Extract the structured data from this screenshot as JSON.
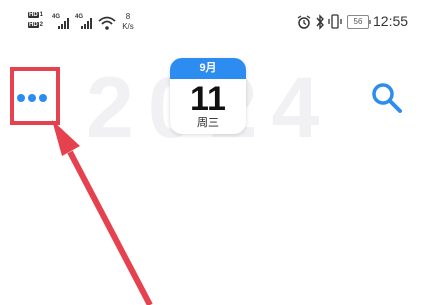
{
  "status_bar": {
    "hd_label": "HD",
    "sim1": "1",
    "sim2": "2",
    "net1": "4G",
    "net2": "4G",
    "net_speed_value": "8",
    "net_speed_unit": "K/s",
    "battery": "56",
    "time": "12:55",
    "icons": [
      "alarm-icon",
      "bluetooth-icon",
      "vibrate-icon",
      "battery-icon",
      "wifi-icon",
      "signal-icon"
    ]
  },
  "header": {
    "watermark_year": "2024",
    "calendar": {
      "month": "9月",
      "day": "11",
      "weekday": "周三"
    },
    "menu_icon": "more-dots-icon",
    "search_icon": "search-icon"
  },
  "colors": {
    "accent": "#2d8cf0",
    "highlight": "#e5414f",
    "watermark": "#f1f1f3"
  }
}
